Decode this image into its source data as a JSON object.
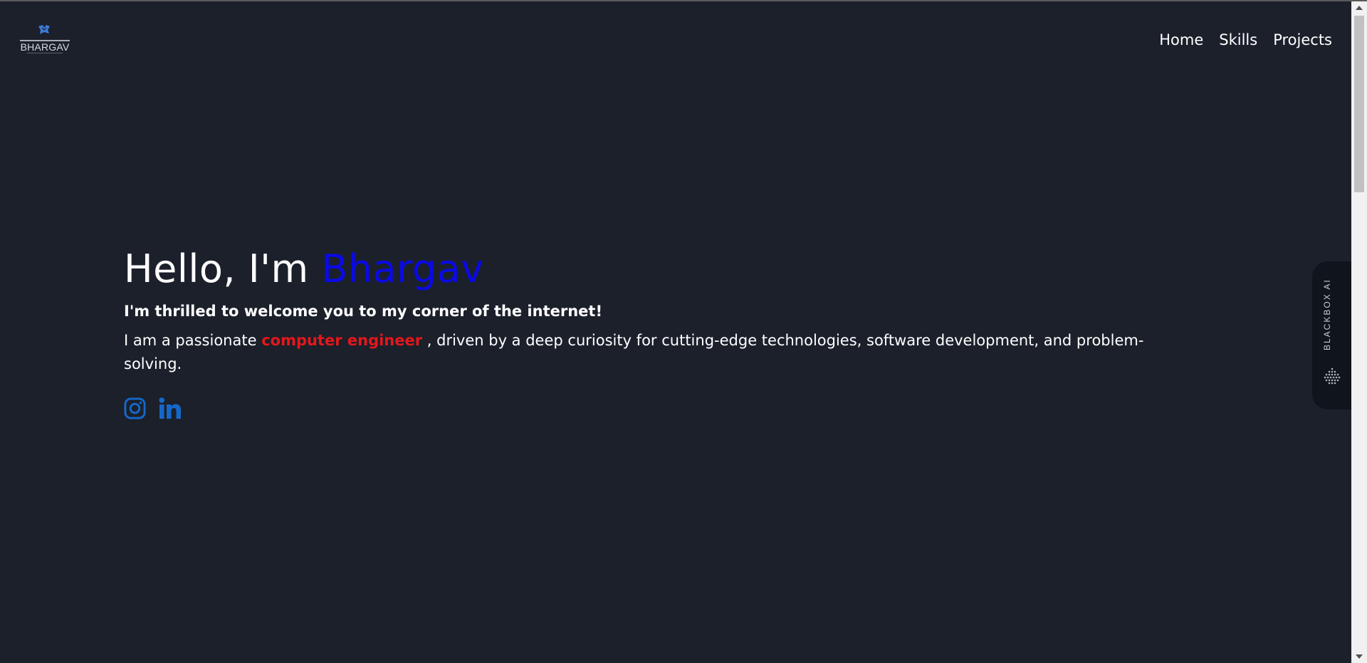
{
  "logo": {
    "text": "BHARGAV",
    "accent": "#3d7bd9"
  },
  "nav": {
    "items": [
      "Home",
      "Skills",
      "Projects"
    ]
  },
  "hero": {
    "greeting": "Hello, I'm ",
    "name": "Bhargav",
    "welcome": "I'm thrilled to welcome you to my corner of the internet!",
    "desc_before": "I am a passionate ",
    "desc_highlight": "computer engineer",
    "desc_after": " , driven by a deep curiosity for cutting-edge technologies, software development, and problem-solving."
  },
  "socials": [
    {
      "icon": "instagram-icon"
    },
    {
      "icon": "linkedin-icon"
    }
  ],
  "blackbox": {
    "label": "BLACKBOX AI"
  },
  "colors": {
    "background": "#1b202b",
    "name": "#0a0ae6",
    "highlight": "#e4171a",
    "social": "#1668c8"
  }
}
